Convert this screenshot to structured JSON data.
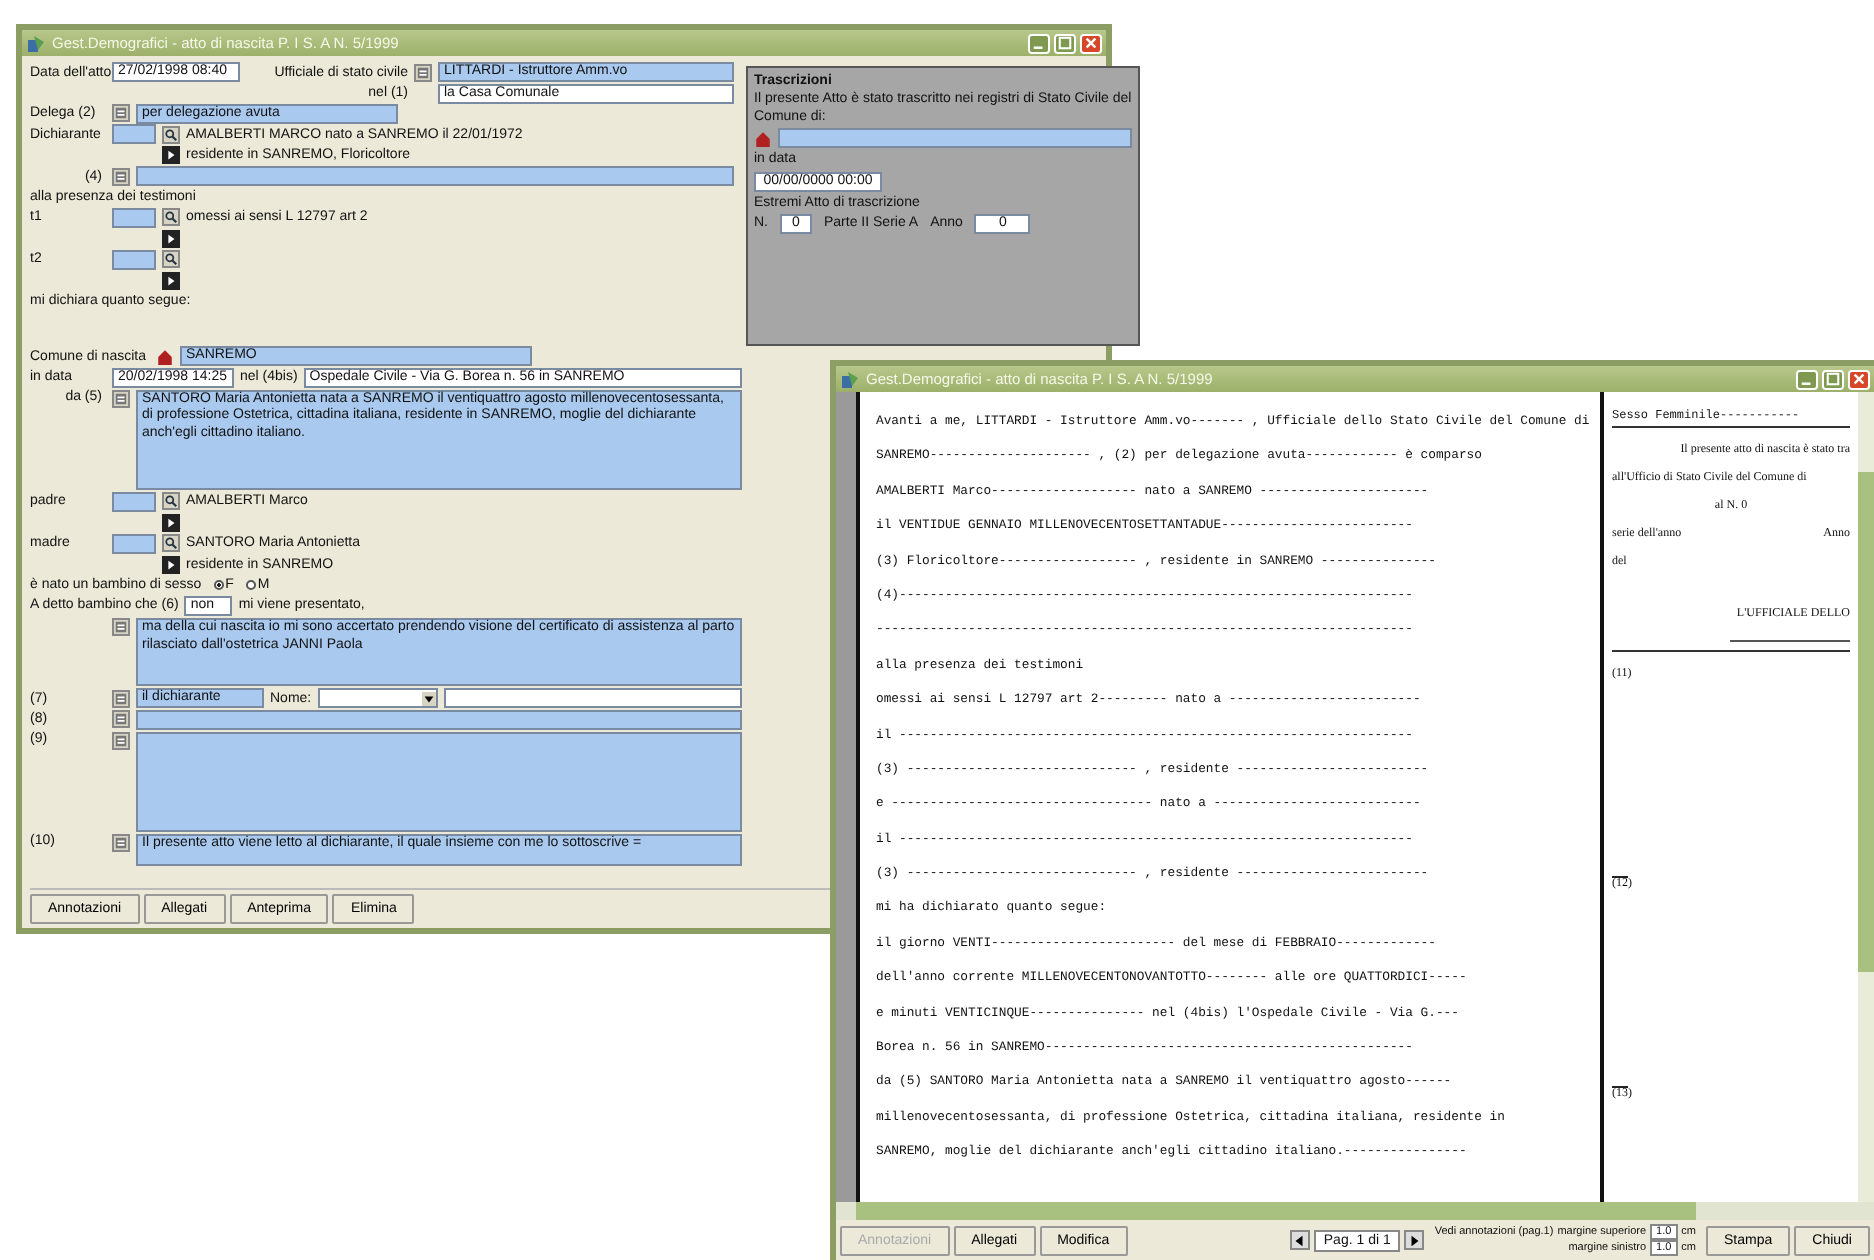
{
  "form_window": {
    "title": "Gest.Demografici - atto di nascita P. I S. A N. 5/1999",
    "data_atto": {
      "label": "Data dell'atto",
      "value": "27/02/1998 08:40"
    },
    "ufficiale": {
      "label": "Ufficiale di stato civile",
      "value": "LITTARDI - Istruttore Amm.vo"
    },
    "nel": {
      "label": "nel (1)",
      "value": "la Casa Comunale"
    },
    "delega": {
      "label": "Delega (2)",
      "value": "per delegazione avuta"
    },
    "dichiarante": {
      "label": "Dichiarante",
      "line1": "AMALBERTI MARCO nato a SANREMO il 22/01/1972",
      "line2": "residente in SANREMO, Floricoltore"
    },
    "nota_4": {
      "label": "(4)"
    },
    "testimoni_heading": "alla presenza dei testimoni",
    "testimoni": [
      {
        "label": "t1",
        "line1": "omessi ai sensi L 12797 art 2"
      },
      {
        "label": "t2"
      }
    ],
    "dichiara_heading": "mi dichiara quanto segue:",
    "comune_nascita": {
      "label": "Comune di nascita",
      "value": "SANREMO"
    },
    "in_data": {
      "label": "in data",
      "value": "20/02/1998 14:25",
      "place_label": "nel (4bis)",
      "place": "Ospedale Civile - Via G. Borea n. 56 in SANREMO"
    },
    "da_5": {
      "label": "da (5)",
      "value": "SANTORO Maria Antonietta nata a SANREMO il ventiquattro agosto millenovecentosessanta, di professione Ostetrica, cittadina italiana, residente in SANREMO, moglie del dichiarante anch'egli cittadino italiano."
    },
    "padre": {
      "label": "padre",
      "line1": "AMALBERTI Marco"
    },
    "madre": {
      "label": "madre",
      "line1": "SANTORO Maria Antonietta",
      "line2": "residente in SANREMO"
    },
    "sesso": {
      "label": "è nato un bambino di sesso",
      "options": [
        {
          "label": "F",
          "selected": true
        },
        {
          "label": "M",
          "selected": false
        }
      ]
    },
    "presentato": {
      "label": "A detto bambino che (6)",
      "value": "non",
      "suffix": "mi viene presentato,"
    },
    "nota_nascita": "ma della cui nascita io mi sono accertato prendendo visione del certificato di assistenza al parto rilasciato dall'ostetrica JANNI Paola",
    "nota_7": {
      "label": "(7)",
      "value": "il dichiarante",
      "name_label": "Nome:"
    },
    "nota_8": {
      "label": "(8)"
    },
    "nota_9": {
      "label": "(9)"
    },
    "nota_10": {
      "label": "(10)",
      "value": "Il presente atto viene letto al dichiarante, il quale insieme con me lo sottoscrive ="
    },
    "buttons": [
      "Annotazioni",
      "Allegati",
      "Anteprima",
      "Elimina"
    ],
    "trascrizioni": {
      "title": "Trascrizioni",
      "intro": "Il presente Atto è stato trascritto nei registri di Stato Civile del",
      "comune_label": "Comune di:",
      "data_label": "in data",
      "data_value": "00/00/0000 00:00",
      "estremi_label": "Estremi Atto di trascrizione",
      "n_label": "N.",
      "n_value": "0",
      "parte": "Parte II Serie A",
      "anno_label": "Anno",
      "anno_value": "0"
    }
  },
  "print_window": {
    "title": "Gest.Demografici - atto di nascita P. I S. A N. 5/1999",
    "lines": [
      "Avanti a me, LITTARDI - Istruttore Amm.vo------- , Ufficiale dello Stato Civile del Comune di",
      "SANREMO--------------------- , (2) per delegazione avuta------------ è comparso",
      "AMALBERTI Marco------------------- nato a SANREMO ----------------------",
      "il VENTIDUE GENNAIO MILLENOVECENTOSETTANTADUE-------------------------",
      "(3) Floricoltore------------------ , residente in SANREMO ---------------",
      "(4)-------------------------------------------------------------------",
      "----------------------------------------------------------------------",
      "alla presenza dei testimoni",
      "omessi ai sensi L 12797 art 2--------- nato a -------------------------",
      "il -------------------------------------------------------------------",
      "(3) ------------------------------ , residente -------------------------",
      "e ---------------------------------- nato a ---------------------------",
      "il -------------------------------------------------------------------",
      "(3) ------------------------------ , residente -------------------------",
      "mi ha dichiarato quanto segue:",
      "il giorno VENTI------------------------ del mese di FEBBRAIO-------------",
      "dell'anno corrente MILLENOVECENTONOVANTOTTO-------- alle ore QUATTORDICI-----",
      "e minuti VENTICINQUE--------------- nel (4bis) l'Ospedale Civile - Via G.---",
      "Borea n. 56 in SANREMO------------------------------------------------",
      "da (5) SANTORO Maria Antonietta nata a SANREMO il ventiquattro agosto------",
      "millenovecentosessanta, di professione Ostetrica, cittadina italiana, residente in",
      "SANREMO, moglie del dichiarante anch'egli cittadino italiano.----------------"
    ],
    "margin": [
      {
        "kind": "heading",
        "text": "Sesso Femminile-----------"
      },
      {
        "kind": "right",
        "text": "Il presente atto di nascita è stato tra"
      },
      {
        "kind": "text",
        "text": "all'Ufficio di Stato Civile del Comune di"
      },
      {
        "kind": "center",
        "text": "al N. 0"
      },
      {
        "kind": "split",
        "text": "serie dell'anno",
        "extra": "Anno"
      },
      {
        "kind": "text",
        "text": "del"
      },
      {
        "kind": "signature",
        "text": "L'UFFICIALE DELLO"
      },
      {
        "kind": "note",
        "text": "(11)"
      },
      {
        "kind": "dashnote",
        "text": "(12)"
      },
      {
        "kind": "dashnote",
        "text": "(13)"
      }
    ],
    "buttons": [
      {
        "label": "Annotazioni",
        "disabled": true
      },
      {
        "label": "Allegati",
        "disabled": false
      },
      {
        "label": "Modifica",
        "disabled": false
      }
    ],
    "page": "Pag. 1 di 1",
    "annotations_label": "Vedi annotazioni (pag.1)",
    "margins": [
      {
        "label": "margine superiore",
        "value": "1.0",
        "unit": "cm"
      },
      {
        "label": "margine sinistro",
        "value": "1.0",
        "unit": "cm"
      }
    ],
    "actions": [
      "Stampa",
      "Chiudi"
    ]
  }
}
